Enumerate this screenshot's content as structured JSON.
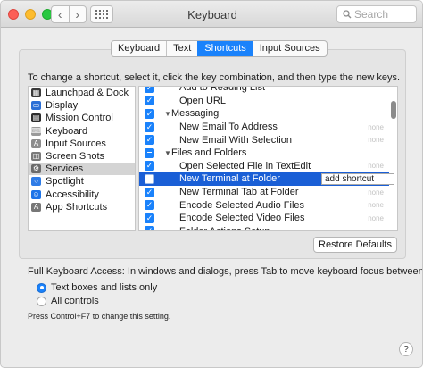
{
  "window": {
    "title": "Keyboard"
  },
  "search": {
    "placeholder": "Search"
  },
  "tabs": [
    {
      "label": "Keyboard",
      "active": false
    },
    {
      "label": "Text",
      "active": false
    },
    {
      "label": "Shortcuts",
      "active": true
    },
    {
      "label": "Input Sources",
      "active": false
    }
  ],
  "instructions": "To change a shortcut, select it, click the key combination, and then type the new keys.",
  "categories": [
    {
      "label": "Launchpad & Dock",
      "icon": "launchpad-icon",
      "color": "#3a3a3a"
    },
    {
      "label": "Display",
      "icon": "display-icon",
      "color": "#2b6fd6"
    },
    {
      "label": "Mission Control",
      "icon": "mission-control-icon",
      "color": "#2d2d2d"
    },
    {
      "label": "Keyboard",
      "icon": "keyboard-icon",
      "color": "#9a9a9a"
    },
    {
      "label": "Input Sources",
      "icon": "input-sources-icon",
      "color": "#8d8d8d"
    },
    {
      "label": "Screen Shots",
      "icon": "screenshot-icon",
      "color": "#7a7a7a"
    },
    {
      "label": "Services",
      "icon": "gear-icon",
      "color": "#6b6b6b",
      "selected": true
    },
    {
      "label": "Spotlight",
      "icon": "spotlight-icon",
      "color": "#2f7ce6"
    },
    {
      "label": "Accessibility",
      "icon": "accessibility-icon",
      "color": "#1d74e8"
    },
    {
      "label": "App Shortcuts",
      "icon": "app-shortcuts-icon",
      "color": "#777777"
    }
  ],
  "services": [
    {
      "kind": "item",
      "label": "Add to Reading List",
      "checked": true,
      "shortcut": ""
    },
    {
      "kind": "item",
      "label": "Open URL",
      "checked": true,
      "shortcut": ""
    },
    {
      "kind": "group",
      "label": "Messaging",
      "state": "checked"
    },
    {
      "kind": "item",
      "label": "New Email To Address",
      "checked": true,
      "shortcut": "none"
    },
    {
      "kind": "item",
      "label": "New Email With Selection",
      "checked": true,
      "shortcut": "none"
    },
    {
      "kind": "group",
      "label": "Files and Folders",
      "state": "mixed"
    },
    {
      "kind": "item",
      "label": "Open Selected File in TextEdit",
      "checked": true,
      "shortcut": "none"
    },
    {
      "kind": "item",
      "label": "New Terminal at Folder",
      "checked": false,
      "shortcut": "add shortcut",
      "selected": true
    },
    {
      "kind": "item",
      "label": "New Terminal Tab at Folder",
      "checked": true,
      "shortcut": "none"
    },
    {
      "kind": "item",
      "label": "Encode Selected Audio Files",
      "checked": true,
      "shortcut": "none"
    },
    {
      "kind": "item",
      "label": "Encode Selected Video Files",
      "checked": true,
      "shortcut": "none"
    },
    {
      "kind": "item",
      "label": "Folder Actions Setup",
      "checked": true,
      "shortcut": ""
    }
  ],
  "restore_button": "Restore Defaults",
  "full_keyboard_access": {
    "label": "Full Keyboard Access: In windows and dialogs, press Tab to move keyboard focus between:",
    "options": [
      {
        "label": "Text boxes and lists only",
        "selected": true
      },
      {
        "label": "All controls",
        "selected": false
      }
    ],
    "hint": "Press Control+F7 to change this setting."
  },
  "help": "?"
}
